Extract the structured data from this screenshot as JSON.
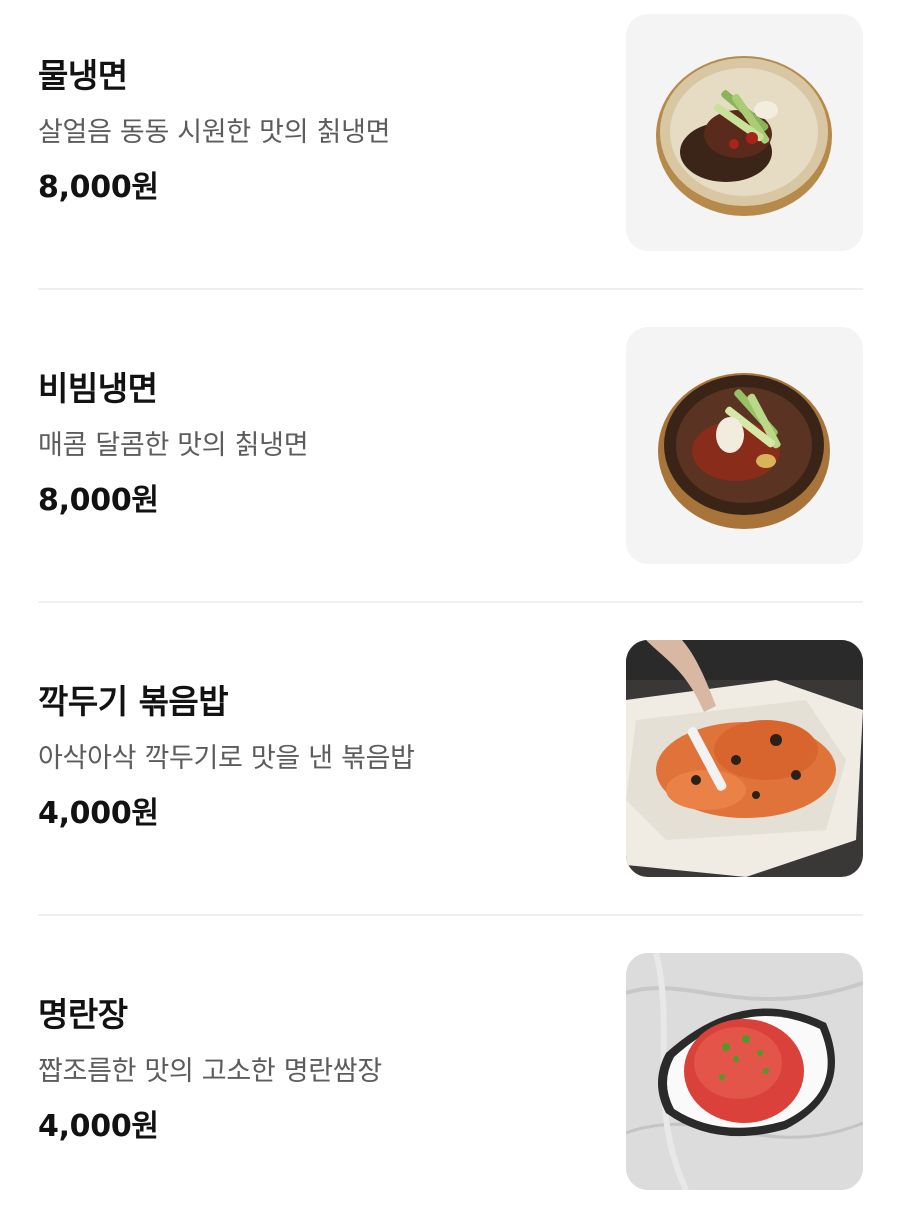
{
  "menu": {
    "items": [
      {
        "name": "물냉면",
        "description": "살얼음 동동 시원한 맛의 칡냉면",
        "price": "8,000원",
        "image": "cold-noodle-soup-image"
      },
      {
        "name": "비빔냉면",
        "description": "매콤 달콤한 맛의 칡냉면",
        "price": "8,000원",
        "image": "spicy-mixed-noodle-image"
      },
      {
        "name": "깍두기 볶음밥",
        "description": "아삭아삭 깍두기로 맛을 낸 볶음밥",
        "price": "4,000원",
        "image": "kimchi-fried-rice-image"
      },
      {
        "name": "명란장",
        "description": "짭조름한 맛의 고소한 명란쌈장",
        "price": "4,000원",
        "image": "pollock-roe-sauce-image"
      }
    ]
  }
}
